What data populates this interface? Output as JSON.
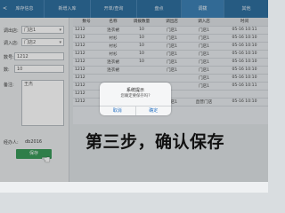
{
  "nav": {
    "back_label": "<",
    "tabs": [
      {
        "label": "库存信息"
      },
      {
        "label": "新增入库"
      },
      {
        "label": "开单/查询"
      },
      {
        "label": "盘点"
      },
      {
        "label": "调拨"
      },
      {
        "label": "其他"
      }
    ],
    "right_label": ""
  },
  "form": {
    "out_store_label": "调出店:",
    "out_store_value": "门店1",
    "in_store_label": "调入店:",
    "in_store_value": "门店2",
    "number_label": "数号:",
    "number_value": "1212",
    "qty_label": "数:",
    "qty_value": "10",
    "note_label": "备注:",
    "note_value": "王杰",
    "operator_label": "经办人:",
    "operator_value": "db2016",
    "save_label": "保存"
  },
  "table": {
    "headers": [
      "数号",
      "名称",
      "调拨数量",
      "调出店",
      "调入店",
      "时间"
    ],
    "rows": [
      [
        "1212",
        "连衣裙",
        "10",
        "门店1",
        "门店1",
        "05-16 10:11"
      ],
      [
        "1212",
        "衬衫",
        "10",
        "门店1",
        "门店1",
        "05-16 10:10"
      ],
      [
        "1212",
        "衬衫",
        "10",
        "门店1",
        "门店1",
        "05-16 10:10"
      ],
      [
        "1212",
        "衬衫",
        "10",
        "门店1",
        "门店1",
        "05-16 10:10"
      ],
      [
        "1212",
        "连衣裙",
        "10",
        "门店1",
        "门店1",
        "05-16 10:10"
      ],
      [
        "1212",
        "连衣裙",
        "",
        "门店1",
        "门店1",
        "05-16 10:10"
      ],
      [
        "1212",
        "",
        "",
        "",
        "门店1",
        "05-16 10:10"
      ],
      [
        "1212",
        "",
        "",
        "",
        "门店1",
        "05-16 10:11"
      ],
      [
        "1212",
        "",
        "",
        "",
        "",
        ""
      ],
      [
        "1212",
        "连衣裙",
        "10",
        "门店1",
        "直营门店",
        "05-16 10:10"
      ]
    ]
  },
  "dialog": {
    "title": "系统提示",
    "message": "您确定要保存吗?",
    "cancel_label": "取消",
    "confirm_label": "确定"
  },
  "caption": "第三步，确认保存",
  "colors": {
    "nav_bg": "#2f6f9f",
    "save_btn": "#3a9a5a",
    "dialog_btn_text": "#2b74c4"
  }
}
